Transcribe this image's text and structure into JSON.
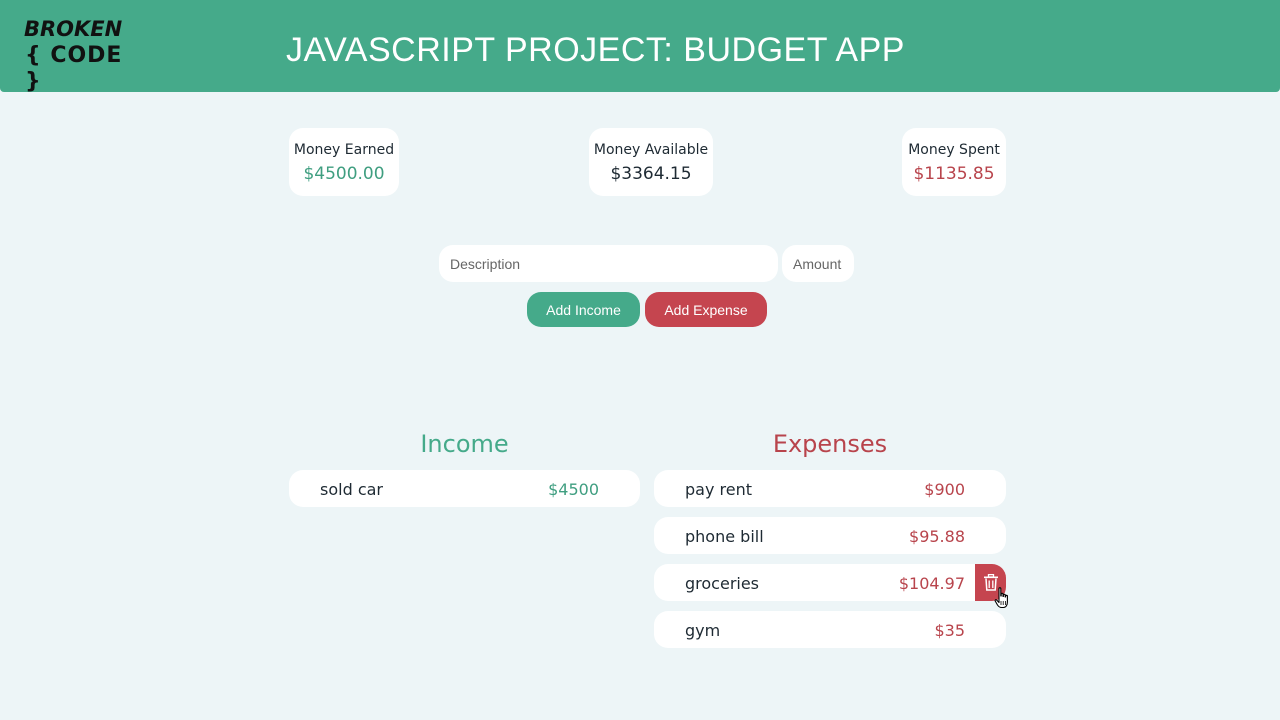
{
  "header": {
    "logo_line1": "BROKEN",
    "logo_line2": "{ CODE }",
    "title": "JAVASCRIPT PROJECT: BUDGET APP"
  },
  "summary": {
    "earned_label": "Money Earned",
    "earned_value": "$4500.00",
    "available_label": "Money Available",
    "available_value": "$3364.15",
    "spent_label": "Money Spent",
    "spent_value": "$1135.85"
  },
  "form": {
    "description_placeholder": "Description",
    "amount_placeholder": "Amount",
    "add_income_label": "Add Income",
    "add_expense_label": "Add Expense"
  },
  "income": {
    "title": "Income",
    "items": [
      {
        "desc": "sold car",
        "amount": "$4500"
      }
    ]
  },
  "expenses": {
    "title": "Expenses",
    "items": [
      {
        "desc": "pay rent",
        "amount": "$900"
      },
      {
        "desc": "phone bill",
        "amount": "$95.88"
      },
      {
        "desc": "groceries",
        "amount": "$104.97"
      },
      {
        "desc": "gym",
        "amount": "$35"
      }
    ]
  },
  "colors": {
    "accent_green": "#45aa8a",
    "accent_red": "#c5454f",
    "background": "#edf5f7"
  },
  "icons": {
    "delete": "trash-icon",
    "cursor": "hand-pointer-icon"
  }
}
